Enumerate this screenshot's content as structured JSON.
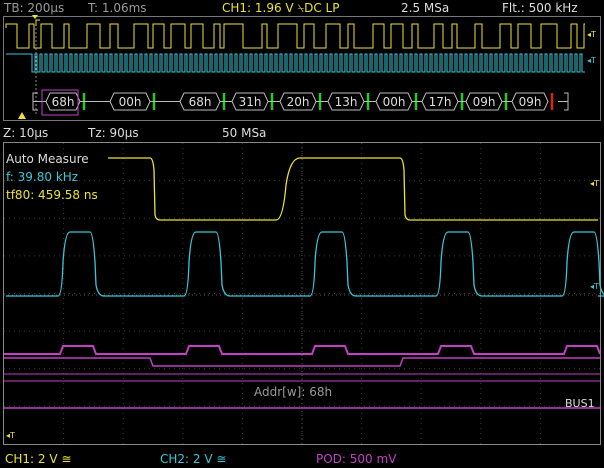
{
  "header": {
    "timebase": "TB: 200µs",
    "trigger_time": "T: 1.06ms",
    "ch1_setting": "CH1: 1.96 V",
    "ch1_coupling": "DC LP",
    "sample_rate": "2.5 MSa",
    "filter": "Flt.: 500 kHz"
  },
  "bus_frames": [
    "68h",
    "00h",
    "68h",
    "31h",
    "20h",
    "13h",
    "00h",
    "17h",
    "09h",
    "09h"
  ],
  "zoom_bar": {
    "zoom": "Z: 10µs",
    "tz": "Tz: 90µs",
    "zoom_rate": "50 MSa"
  },
  "measure": {
    "title": "Auto Measure",
    "freq": "f: 39.80 kHz",
    "fall_time": "tf80: 459.58 ns"
  },
  "decode": {
    "addr_text": "Addr[w]: 68h",
    "bus_label": "BUS1"
  },
  "footer": {
    "ch1": "CH1: 2 V",
    "ch2": "CH2: 2 V",
    "pod": "POD: 500 mV"
  },
  "colors": {
    "ch1": "#ece233",
    "ch2": "#38c8d8",
    "pod": "#c33fc3",
    "ack": "#22cc22",
    "nack": "#e02020"
  }
}
